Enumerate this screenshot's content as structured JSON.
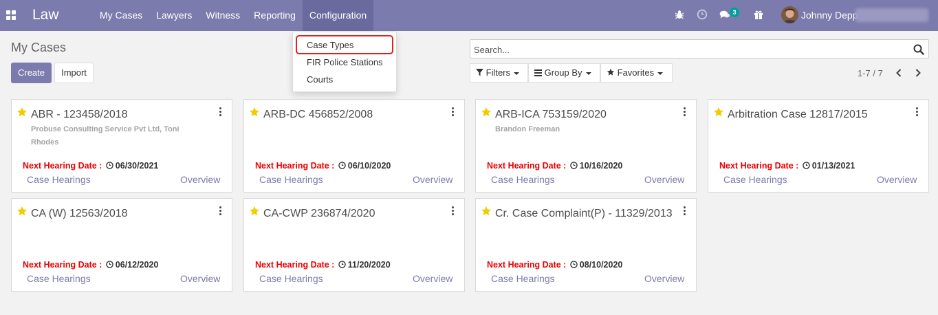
{
  "navbar": {
    "app_name": "Law",
    "menu": [
      "My Cases",
      "Lawyers",
      "Witness",
      "Reporting",
      "Configuration"
    ],
    "active_menu": "Configuration",
    "message_count": "3",
    "user_name": "Johnny Depp",
    "color": "#7c7bad"
  },
  "config_dropdown": {
    "items": [
      "Case Types",
      "FIR Police Stations",
      "Courts"
    ],
    "highlighted": "Case Types"
  },
  "page": {
    "title": "My Cases",
    "create_label": "Create",
    "import_label": "Import"
  },
  "search": {
    "placeholder": "Search..."
  },
  "filters": {
    "filters_label": "Filters",
    "group_by_label": "Group By",
    "favorites_label": "Favorites"
  },
  "pager": {
    "value": "1-7 / 7"
  },
  "cards": [
    {
      "title": "ABR - 123458/2018",
      "client": "Probuse Consulting Service Pvt Ltd, Toni Rhodes",
      "hearing_label": "Next Hearing Date :",
      "hearing_date": "06/30/2021",
      "link_hearings": "Case Hearings",
      "link_overview": "Overview"
    },
    {
      "title": "ARB-DC 456852/2008",
      "client": "",
      "hearing_label": "Next Hearing Date :",
      "hearing_date": "06/10/2020",
      "link_hearings": "Case Hearings",
      "link_overview": "Overview"
    },
    {
      "title": "ARB-ICA 753159/2020",
      "client": "Brandon Freeman",
      "hearing_label": "Next Hearing Date :",
      "hearing_date": "10/16/2020",
      "link_hearings": "Case Hearings",
      "link_overview": "Overview"
    },
    {
      "title": "Arbitration Case 12817/2015",
      "client": "",
      "hearing_label": "Next Hearing Date :",
      "hearing_date": "01/13/2021",
      "link_hearings": "Case Hearings",
      "link_overview": "Overview"
    },
    {
      "title": "CA (W) 12563/2018",
      "client": "",
      "hearing_label": "Next Hearing Date :",
      "hearing_date": "06/12/2020",
      "link_hearings": "Case Hearings",
      "link_overview": "Overview"
    },
    {
      "title": "CA-CWP 236874/2020",
      "client": "",
      "hearing_label": "Next Hearing Date :",
      "hearing_date": "11/20/2020",
      "link_hearings": "Case Hearings",
      "link_overview": "Overview"
    },
    {
      "title": "Cr. Case Complaint(P) - 11329/2013",
      "client": "",
      "hearing_label": "Next Hearing Date :",
      "hearing_date": "08/10/2020",
      "link_hearings": "Case Hearings",
      "link_overview": "Overview"
    }
  ]
}
